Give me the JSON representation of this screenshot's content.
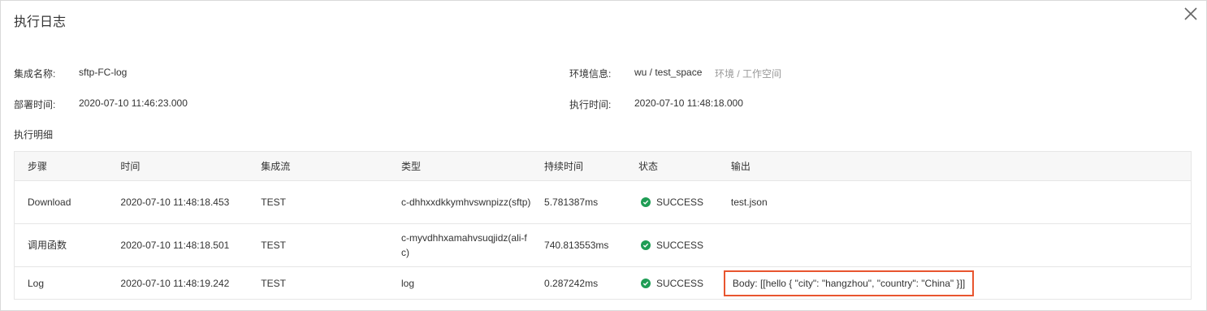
{
  "dialog": {
    "title": "执行日志"
  },
  "info": {
    "integration_name_label": "集成名称:",
    "integration_name_value": "sftp-FC-log",
    "env_label": "环境信息:",
    "env_value": "wu / test_space",
    "env_hint": "环境 / 工作空间",
    "deploy_time_label": "部署时间:",
    "deploy_time_value": "2020-07-10 11:46:23.000",
    "exec_time_label": "执行时间:",
    "exec_time_value": "2020-07-10 11:48:18.000"
  },
  "details": {
    "title": "执行明细",
    "columns": [
      "步骤",
      "时间",
      "集成流",
      "类型",
      "持续时间",
      "状态",
      "输出"
    ],
    "rows": [
      {
        "step": "Download",
        "time": "2020-07-10 11:48:18.453",
        "flow": "TEST",
        "type": "c-dhhxxdkkymhvswnpizz(sftp)",
        "duration": "5.781387ms",
        "status": "SUCCESS",
        "output": "test.json"
      },
      {
        "step": "调用函数",
        "time": "2020-07-10 11:48:18.501",
        "flow": "TEST",
        "type": "c-myvdhhxamahvsuqjidz(ali-fc)",
        "duration": "740.813553ms",
        "status": "SUCCESS",
        "output": ""
      },
      {
        "step": "Log",
        "time": "2020-07-10 11:48:19.242",
        "flow": "TEST",
        "type": "log",
        "duration": "0.287242ms",
        "status": "SUCCESS",
        "output": "Body: [[hello { \"city\": \"hangzhou\", \"country\": \"China\" }]]"
      }
    ]
  },
  "icons": {
    "close": "close-icon",
    "success": "check-circle-icon"
  },
  "colors": {
    "success": "#1f9d55",
    "highlight_border": "#e8552f",
    "header_bg": "#f7f7f7"
  }
}
